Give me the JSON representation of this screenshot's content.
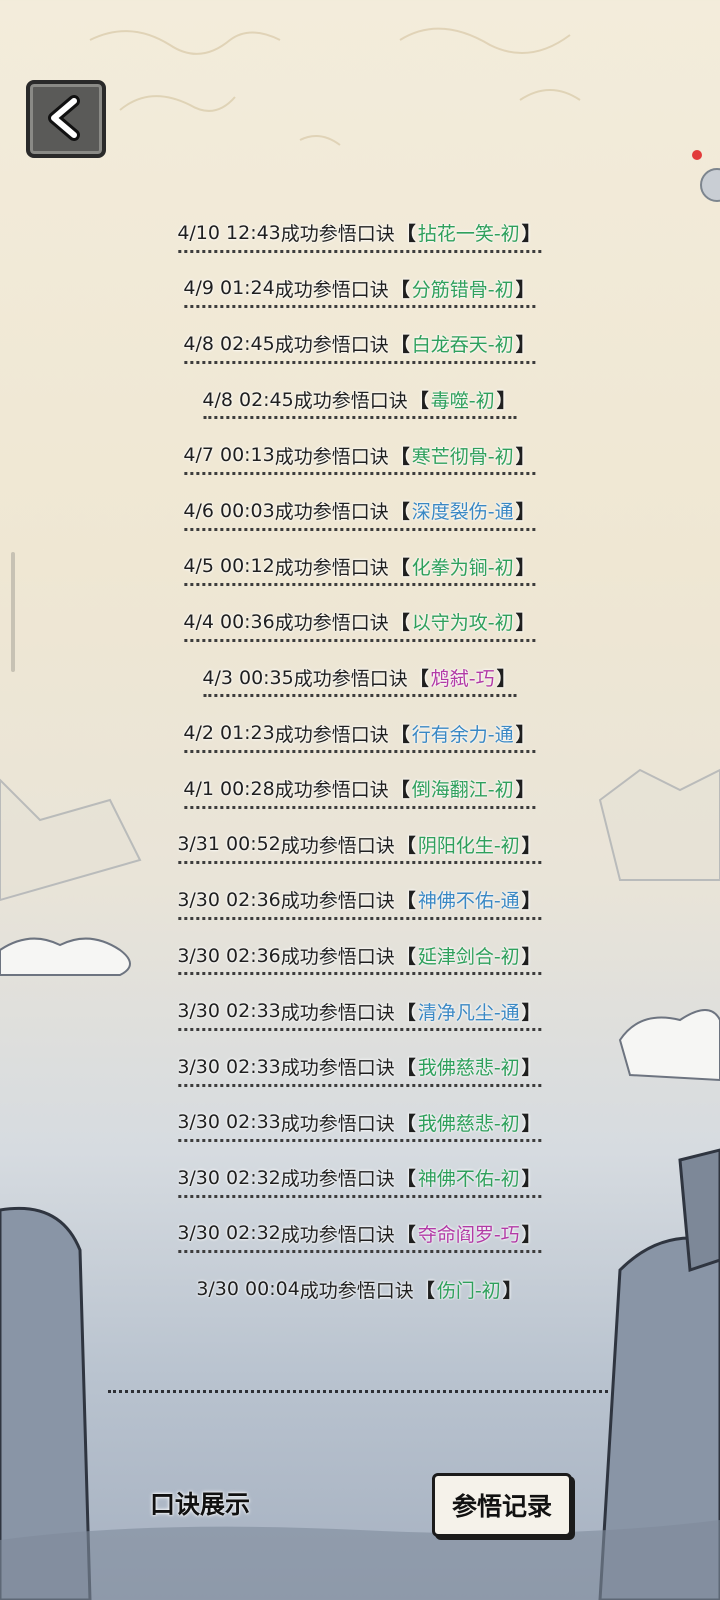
{
  "nav": {
    "back_icon": "chevron-left-icon"
  },
  "colors": {
    "chu": "#2fa05c",
    "tong": "#3a88c4",
    "qiao": "#b23aa6"
  },
  "records": [
    {
      "time": "4/10 12:43",
      "action": "成功参悟口诀",
      "skill": "拈花一笑-初",
      "tier": "chu"
    },
    {
      "time": "4/9 01:24",
      "action": "成功参悟口诀",
      "skill": "分筋错骨-初",
      "tier": "chu"
    },
    {
      "time": "4/8 02:45",
      "action": "成功参悟口诀",
      "skill": "白龙吞天-初",
      "tier": "chu"
    },
    {
      "time": "4/8 02:45",
      "action": "成功参悟口诀",
      "skill": "毒噬-初",
      "tier": "chu"
    },
    {
      "time": "4/7 00:13",
      "action": "成功参悟口诀",
      "skill": "寒芒彻骨-初",
      "tier": "chu"
    },
    {
      "time": "4/6 00:03",
      "action": "成功参悟口诀",
      "skill": "深度裂伤-通",
      "tier": "tong"
    },
    {
      "time": "4/5 00:12",
      "action": "成功参悟口诀",
      "skill": "化拳为锏-初",
      "tier": "chu"
    },
    {
      "time": "4/4 00:36",
      "action": "成功参悟口诀",
      "skill": "以守为攻-初",
      "tier": "chu"
    },
    {
      "time": "4/3 00:35",
      "action": "成功参悟口诀",
      "skill": "鸩弑-巧",
      "tier": "qiao"
    },
    {
      "time": "4/2 01:23",
      "action": "成功参悟口诀",
      "skill": "行有余力-通",
      "tier": "tong"
    },
    {
      "time": "4/1 00:28",
      "action": "成功参悟口诀",
      "skill": "倒海翻江-初",
      "tier": "chu"
    },
    {
      "time": "3/31 00:52",
      "action": "成功参悟口诀",
      "skill": "阴阳化生-初",
      "tier": "chu"
    },
    {
      "time": "3/30 02:36",
      "action": "成功参悟口诀",
      "skill": "神佛不佑-通",
      "tier": "tong"
    },
    {
      "time": "3/30 02:36",
      "action": "成功参悟口诀",
      "skill": "延津剑合-初",
      "tier": "chu"
    },
    {
      "time": "3/30 02:33",
      "action": "成功参悟口诀",
      "skill": "清净凡尘-通",
      "tier": "tong"
    },
    {
      "time": "3/30 02:33",
      "action": "成功参悟口诀",
      "skill": "我佛慈悲-初",
      "tier": "chu"
    },
    {
      "time": "3/30 02:33",
      "action": "成功参悟口诀",
      "skill": "我佛慈悲-初",
      "tier": "chu"
    },
    {
      "time": "3/30 02:32",
      "action": "成功参悟口诀",
      "skill": "神佛不佑-初",
      "tier": "chu"
    },
    {
      "time": "3/30 02:32",
      "action": "成功参悟口诀",
      "skill": "夺命阎罗-巧",
      "tier": "qiao"
    },
    {
      "time": "3/30 00:04",
      "action": "成功参悟口诀",
      "skill": "伤门-初",
      "tier": "chu"
    }
  ],
  "bracket_open": "【",
  "bracket_close": "】",
  "tabs": {
    "left_label": "口诀展示",
    "right_label": "参悟记录"
  }
}
